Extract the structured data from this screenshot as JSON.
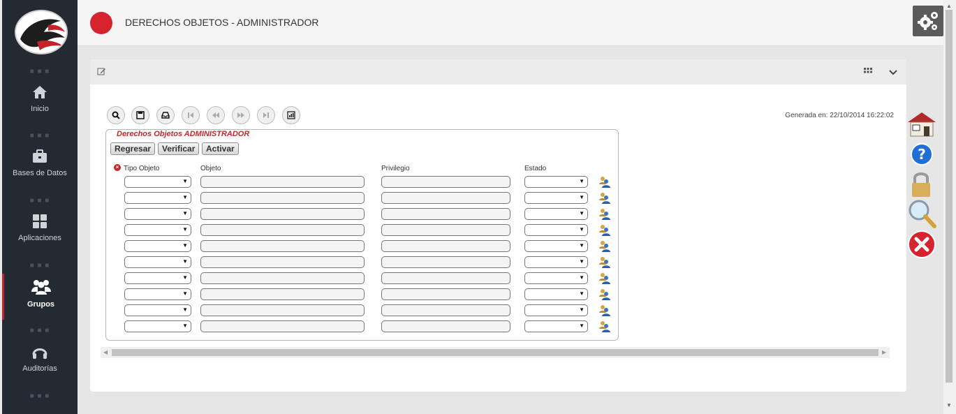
{
  "header": {
    "title": "DERECHOS OBJETOS - ADMINISTRADOR"
  },
  "sidebar": {
    "items": [
      {
        "label": "Inicio",
        "icon": "home-icon",
        "active": false
      },
      {
        "label": "Bases de Datos",
        "icon": "briefcase-icon",
        "active": false
      },
      {
        "label": "Aplicaciones",
        "icon": "grid-icon",
        "active": true
      },
      {
        "label": "Grupos",
        "icon": "users-icon",
        "active": true
      },
      {
        "label": "Auditorías",
        "icon": "headphones-icon",
        "active": false
      }
    ],
    "separator": "■ ■ ■"
  },
  "panel": {
    "generated": "Generada en: 22/10/2014 16:22:02",
    "legend": "Derechos Objetos ADMINISTRADOR",
    "buttons": {
      "regresar": "Regresar",
      "verificar": "Verificar",
      "activar": "Activar"
    },
    "columns": {
      "tipo": "Tipo Objeto",
      "objeto": "Objeto",
      "privilegio": "Privilegio",
      "estado": "Estado"
    },
    "row_count": 10
  },
  "colors": {
    "accent": "#d7232e",
    "sidebar": "#232a31",
    "legend": "#c62828"
  }
}
